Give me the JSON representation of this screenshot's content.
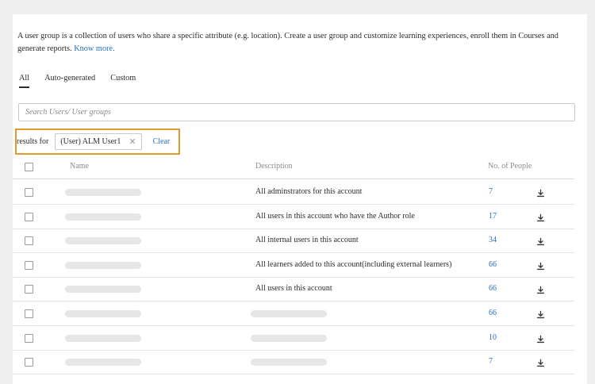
{
  "intro": {
    "text": "A user group is a collection of users who share a specific attribute (e.g. location). Create a user group and customize learning experiences, enroll them in Courses and generate reports. ",
    "link": "Know more."
  },
  "tabs": [
    {
      "label": "All",
      "active": true
    },
    {
      "label": "Auto-generated",
      "active": false
    },
    {
      "label": "Custom",
      "active": false
    }
  ],
  "search": {
    "placeholder": "Search Users/ User groups",
    "value": ""
  },
  "filter": {
    "label": "results for",
    "chip": "(User) ALM User1",
    "clear": "Clear",
    "highlight_color": "#e49b2e"
  },
  "table": {
    "columns": {
      "name": "Name",
      "description": "Description",
      "people": "No. of People"
    },
    "rows": [
      {
        "description": "All adminstrators for this account",
        "count": "7"
      },
      {
        "description": "All users in this account who have the Author role",
        "count": "17"
      },
      {
        "description": "All internal users in this account",
        "count": "34"
      },
      {
        "description": "All learners added to this account(including external learners)",
        "count": "66"
      },
      {
        "description": "All users in this account",
        "count": "66"
      },
      {
        "description": "",
        "count": "66"
      },
      {
        "description": "",
        "count": "10"
      },
      {
        "description": "",
        "count": "7"
      }
    ]
  },
  "icons": {
    "row_action": "download-icon",
    "chip_remove": "close-icon"
  },
  "colors": {
    "link": "#2a6fbd",
    "highlight": "#e49b2e",
    "placeholder_bar": "#e6e6e6"
  }
}
